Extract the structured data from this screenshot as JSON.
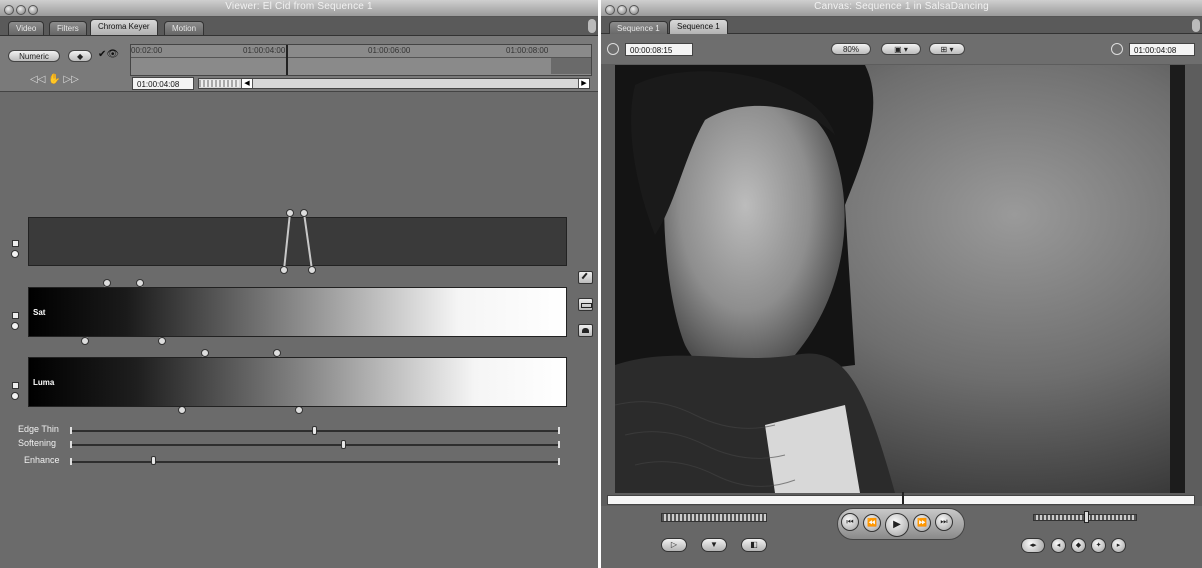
{
  "viewer": {
    "title": "Viewer: El Cid from Sequence 1",
    "tabs": [
      {
        "label": "Video"
      },
      {
        "label": "Filters"
      },
      {
        "label": "Chroma Keyer"
      },
      {
        "label": "Motion"
      }
    ],
    "numeric_button": "Numeric",
    "ruler_ticks": [
      "00:02:00",
      "01:00:04:00",
      "01:00:06:00",
      "01:00:08:00"
    ],
    "current_timecode": "01:00:04:08",
    "bars": [
      {
        "label": ""
      },
      {
        "label": "Sat"
      },
      {
        "label": "Luma"
      }
    ],
    "sliders": [
      {
        "label": "Edge Thin",
        "value": 0.5
      },
      {
        "label": "Softening",
        "value": 0.56
      },
      {
        "label": "Enhance",
        "value": 0.17
      }
    ]
  },
  "canvas": {
    "title": "Canvas: Sequence 1 in SalsaDancing",
    "tabs": [
      {
        "label": "Sequence 1"
      },
      {
        "label": "Sequence 1"
      }
    ],
    "duration_timecode": "00:00:08:15",
    "zoom": "80%",
    "current_timecode": "01:00:04:08",
    "playhead_position": 0.5,
    "jog_position": 0.5
  },
  "colors": {
    "panel_bg": "#6b6b6b",
    "hue_bar": "#3a3a3a",
    "title_text": "#f2f2f2"
  },
  "icons": {
    "viewer_traffic": [
      "close-icon",
      "minimize-icon",
      "zoom-icon"
    ],
    "transport": [
      "play-in-to-out-icon",
      "previous-edit-icon",
      "play-icon",
      "next-edit-icon",
      "mark-clip-icon"
    ]
  }
}
